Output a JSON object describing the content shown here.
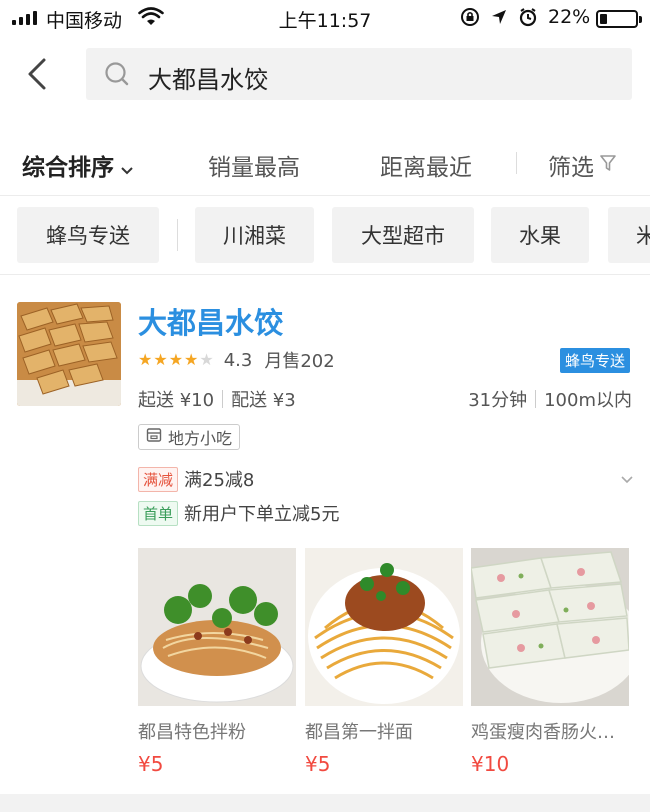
{
  "status_bar": {
    "carrier": "中国移动",
    "time": "上午11:57",
    "battery_pct": "22%",
    "battery_level": 0.22
  },
  "search": {
    "query": "大都昌水饺"
  },
  "sort_bar": {
    "items": [
      {
        "label": "综合排序",
        "active": true
      },
      {
        "label": "销量最高",
        "active": false
      },
      {
        "label": "距离最近",
        "active": false
      }
    ],
    "filter_label": "筛选"
  },
  "quick_tags": [
    {
      "label": "蜂鸟专送"
    },
    {
      "label": "川湘菜"
    },
    {
      "label": "大型超市"
    },
    {
      "label": "水果"
    },
    {
      "label": "米"
    }
  ],
  "shop": {
    "name": "大都昌水饺",
    "rating": "4.3",
    "rating_value": 4.3,
    "monthly_sales": "月售202",
    "delivery_badge": "蜂鸟专送",
    "min_order": "起送 ¥10",
    "delivery_fee": "配送 ¥3",
    "eta": "31分钟",
    "distance": "100m以内",
    "category": "地方小吃",
    "promos": [
      {
        "badge": "满减",
        "text": "满25减8",
        "color": "red"
      },
      {
        "badge": "首单",
        "text": "新用户下单立减5元",
        "color": "green"
      }
    ],
    "dishes": [
      {
        "name": "都昌特色拌粉",
        "price": "¥5"
      },
      {
        "name": "都昌第一拌面",
        "price": "¥5"
      },
      {
        "name": "鸡蛋瘦肉香肠火…",
        "price": "¥10"
      }
    ]
  },
  "colors": {
    "accent_blue": "#2b8fe0",
    "price_red": "#f14a40",
    "star_orange": "#f5a623",
    "star_gray": "#d8d8d8"
  }
}
